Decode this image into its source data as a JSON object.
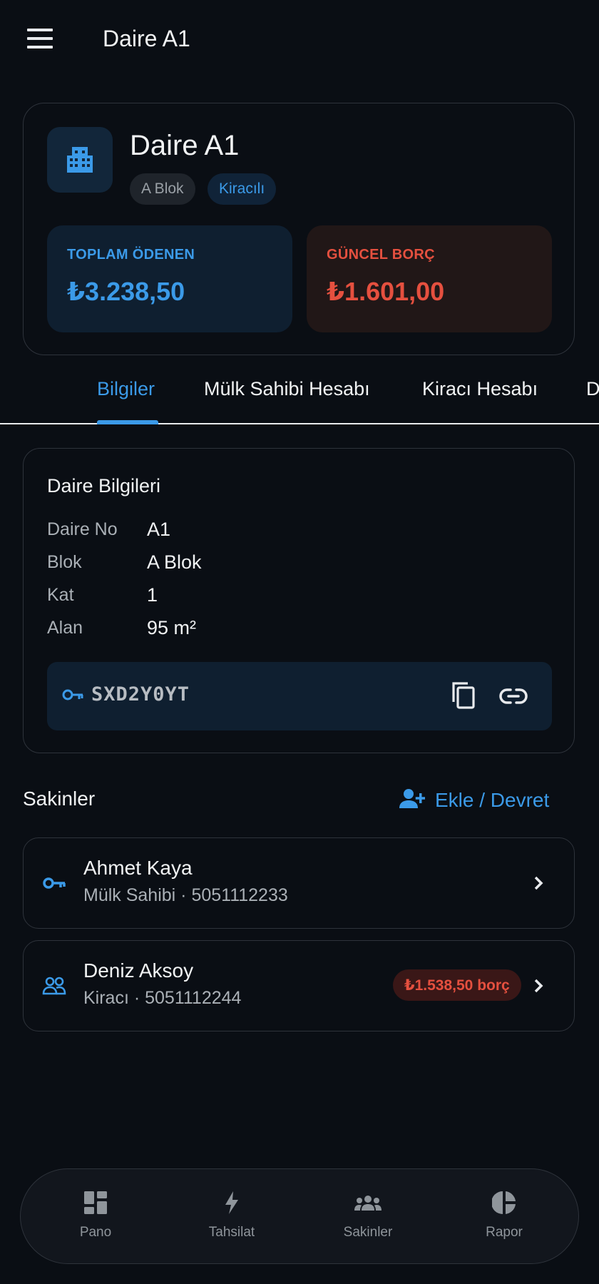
{
  "appbar": {
    "title": "Daire A1"
  },
  "summary": {
    "name": "Daire A1",
    "chips": [
      "A Blok",
      "Kiracılı"
    ],
    "paid": {
      "label": "TOPLAM ÖDENEN",
      "value": "₺3.238,50"
    },
    "debt": {
      "label": "GÜNCEL BORÇ",
      "value": "₺1.601,00"
    }
  },
  "tabs": [
    "Bilgiler",
    "Mülk Sahibi Hesabı",
    "Kiracı Hesabı",
    "D"
  ],
  "info": {
    "title": "Daire Bilgileri",
    "rows": [
      {
        "key": "Daire No",
        "value": "A1"
      },
      {
        "key": "Blok",
        "value": "A Blok"
      },
      {
        "key": "Kat",
        "value": "1"
      },
      {
        "key": "Alan",
        "value": "95 m²"
      }
    ],
    "code": "SXD2Y0YT"
  },
  "residents": {
    "title": "Sakinler",
    "add_label": "Ekle / Devret",
    "items": [
      {
        "name": "Ahmet Kaya",
        "sub": "Mülk Sahibi · 5051112233",
        "icon": "key-icon"
      },
      {
        "name": "Deniz Aksoy",
        "sub": "Kiracı · 5051112244",
        "icon": "people-icon",
        "badge": "₺1.538,50 borç"
      }
    ]
  },
  "nav": [
    "Pano",
    "Tahsilat",
    "Sakinler",
    "Rapor"
  ],
  "colors": {
    "accent": "#3b9ae8",
    "danger": "#e5503f",
    "background": "#0a0e14"
  }
}
